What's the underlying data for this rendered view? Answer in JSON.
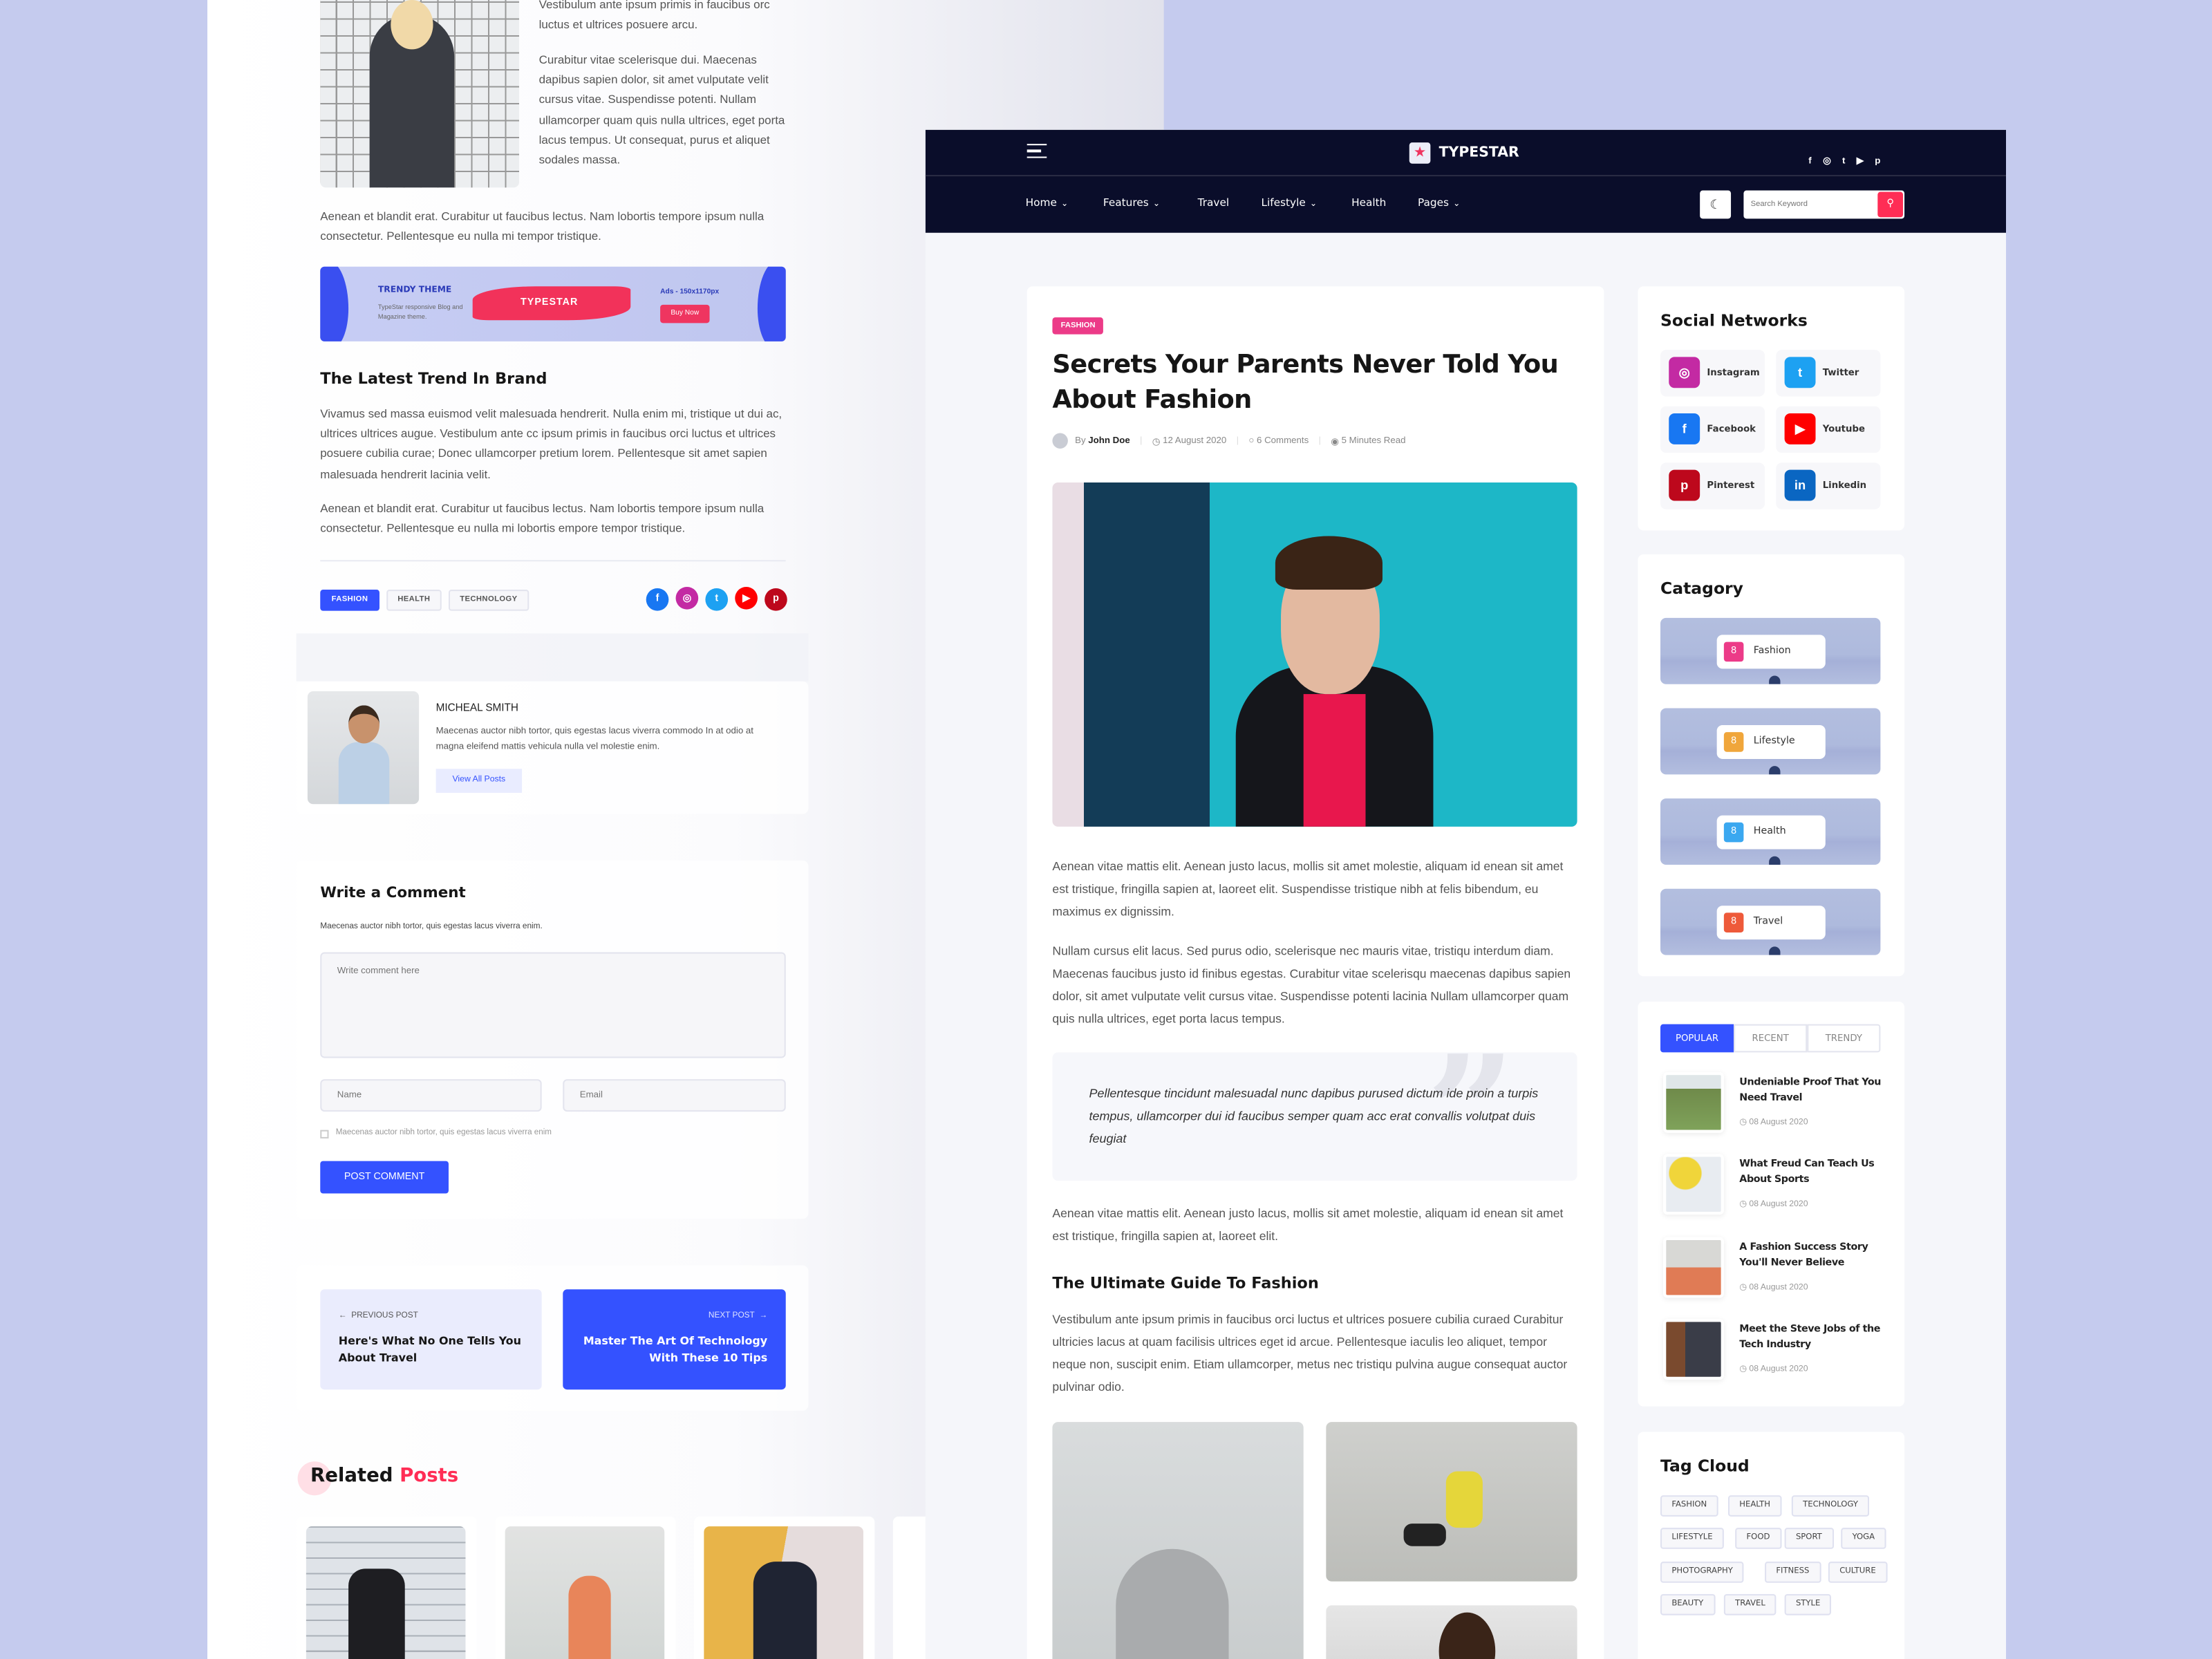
{
  "colors": {
    "accent": "#3452ff",
    "pink": "#ff2d55",
    "navy": "#0a0d2a",
    "background": "#c5cbee",
    "fashion": "#ec3b88"
  },
  "left": {
    "intro_side": [
      "Vestibulum ante ipsum primis in faucibus orc luctus et ultrices posuere arcu.",
      "Curabitur vitae scelerisque dui. Maecenas dapibus sapien dolor, sit amet vulputate velit cursus vitae. Suspendisse potenti. Nullam ullamcorper quam quis nulla ultrices, eget porta lacus tempus. Ut consequat, purus et aliquet sodales massa."
    ],
    "para1": "Aenean et blandit erat. Curabitur ut faucibus lectus. Nam lobortis tempore ipsum nulla consectetur. Pellentesque eu nulla mi tempor tristique.",
    "ad": {
      "title": "TRENDY THEME",
      "subtitle": "TypeStar responsive Blog and Magazine theme.",
      "logo": "TYPESTAR",
      "size": "Ads - 150x1170px",
      "button": "Buy Now"
    },
    "heading": "The Latest Trend In Brand",
    "para2": "Vivamus sed massa euismod velit malesuada hendrerit. Nulla enim mi, tristique ut dui ac, ultrices ultrices augue. Vestibulum ante cc ipsum primis in faucibus orci luctus et ultrices posuere cubilia curae; Donec ullamcorper pretium lorem. Pellentesque sit amet sapien malesuada hendrerit lacinia velit.",
    "para3": "Aenean et blandit erat. Curabitur ut faucibus lectus. Nam lobortis tempore ipsum nulla consectetur. Pellentesque eu nulla mi lobortis empore tempor tristique.",
    "tags": [
      "FASHION",
      "HEALTH",
      "TECHNOLOGY"
    ],
    "share_icons": [
      "facebook-icon",
      "instagram-icon",
      "twitter-icon",
      "youtube-icon",
      "pinterest-icon"
    ],
    "author": {
      "name": "MICHEAL SMITH",
      "bio": "Maecenas auctor nibh tortor, quis egestas lacus viverra commodo In at odio at magna eleifend mattis vehicula nulla vel molestie enim.",
      "button": "View All Posts"
    },
    "comment": {
      "title": "Write a Comment",
      "subtitle": "Maecenas auctor nibh tortor, quis egestas lacus viverra enim.",
      "textarea_placeholder": "Write comment here",
      "name_placeholder": "Name",
      "email_placeholder": "Email",
      "checkbox_label": "Maecenas auctor nibh tortor, quis egestas lacus viverra enim",
      "submit": "POST COMMENT"
    },
    "prev": {
      "label": "PREVIOUS POST",
      "title": "Here's What No One Tells You About Travel"
    },
    "next": {
      "label": "NEXT POST",
      "title": "Master The Art Of Technology With These 10 Tips"
    },
    "related": {
      "title_a": "Related",
      "title_b": "Posts"
    }
  },
  "header": {
    "logo": "TYPESTAR",
    "social": [
      "f",
      "◎",
      "t",
      "▶",
      "p"
    ],
    "nav": [
      {
        "label": "Home",
        "dropdown": true
      },
      {
        "label": "Features",
        "dropdown": true
      },
      {
        "label": "Travel",
        "dropdown": false
      },
      {
        "label": "Lifestyle",
        "dropdown": true
      },
      {
        "label": "Health",
        "dropdown": false
      },
      {
        "label": "Pages",
        "dropdown": true
      }
    ],
    "search_placeholder": "Search Keyword"
  },
  "article": {
    "category": "FASHION",
    "title": "Secrets Your Parents Never Told You About Fashion",
    "by": "By",
    "author": "John Doe",
    "date": "12 August 2020",
    "comments": "6 Comments",
    "read": "5 Minutes Read",
    "p1": "Aenean vitae mattis elit. Aenean justo lacus, mollis sit amet molestie, aliquam id enean sit amet est tristique, fringilla sapien at, laoreet elit. Suspendisse tristique nibh at felis bibendum, eu maximus ex dignissim.",
    "p2": "Nullam cursus elit lacus. Sed purus odio, scelerisque nec mauris vitae, tristiqu interdum diam. Maecenas faucibus justo id finibus egestas. Curabitur vitae scelerisqu maecenas dapibus sapien dolor, sit amet vulputate velit cursus vitae. Suspendisse potenti lacinia Nullam ullamcorper quam quis nulla ultrices, eget porta lacus tempus.",
    "quote": "Pellentesque tincidunt malesuadal nunc dapibus purused dictum ide proin a turpis tempus, ullamcorper dui id faucibus semper quam acc erat convallis volutpat duis feugiat",
    "p3": "Aenean vitae mattis elit. Aenean justo lacus, mollis sit amet molestie, aliquam id enean sit amet est tristique, fringilla sapien at, laoreet elit.",
    "h2": "The Ultimate Guide To Fashion",
    "p4": " Vestibulum ante ipsum primis in faucibus orci luctus et ultrices posuere cubilia curaed Curabitur ultricies lacus at quam facilisis ultrices eget id arcue. Pellentesque iaculis leo aliquet, tempor neque non, suscipit enim. Etiam ullamcorper, metus nec tristiqu pulvina augue consequat auctor pulvinar odio."
  },
  "sidebar": {
    "social": {
      "title": "Social Networks",
      "items": [
        {
          "label": "Instagram",
          "color": "#c32aa3",
          "glyph": "◎"
        },
        {
          "label": "Twitter",
          "color": "#1da1f2",
          "glyph": "t"
        },
        {
          "label": "Facebook",
          "color": "#1877f2",
          "glyph": "f"
        },
        {
          "label": "Youtube",
          "color": "#ff0000",
          "glyph": "▶"
        },
        {
          "label": "Pinterest",
          "color": "#bd081c",
          "glyph": "p"
        },
        {
          "label": "Linkedin",
          "color": "#0a66c2",
          "glyph": "in"
        }
      ]
    },
    "category": {
      "title": "Catagory",
      "items": [
        {
          "count": "8",
          "label": "Fashion",
          "color": "#ec3b88"
        },
        {
          "count": "8",
          "label": "Lifestyle",
          "color": "#f0a63b"
        },
        {
          "count": "8",
          "label": "Health",
          "color": "#3ba8f0"
        },
        {
          "count": "8",
          "label": "Travel",
          "color": "#ee5a3a"
        }
      ]
    },
    "tabs": [
      "POPULAR",
      "RECENT",
      "TRENDY"
    ],
    "posts": [
      {
        "title": "Undeniable Proof That You Need Travel",
        "date": "08 August 2020"
      },
      {
        "title": "What Freud Can Teach Us About Sports",
        "date": "08 August 2020"
      },
      {
        "title": "A Fashion Success Story You'll Never Believe",
        "date": "08 August 2020"
      },
      {
        "title": "Meet the Steve Jobs of the Tech Industry",
        "date": "08 August 2020"
      }
    ],
    "tagcloud": {
      "title": "Tag Cloud",
      "tags": [
        "FASHION",
        "HEALTH",
        "TECHNOLOGY",
        "LIFESTYLE",
        "FOOD",
        "SPORT",
        "YOGA",
        "PHOTOGRAPHY",
        "FITNESS",
        "CULTURE",
        "BEAUTY",
        "TRAVEL",
        "STYLE"
      ]
    }
  }
}
